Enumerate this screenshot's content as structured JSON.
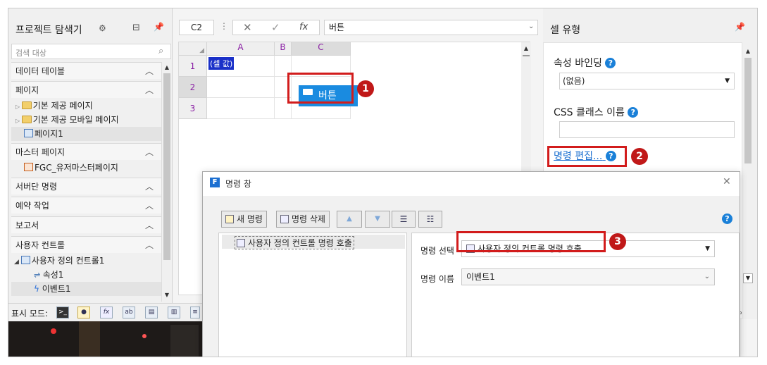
{
  "project_explorer": {
    "title": "프로젝트 탐색기",
    "search_placeholder": "검색 대상",
    "sections": [
      {
        "label": "데이터 테이블"
      },
      {
        "label": "페이지",
        "items": [
          "기본 제공 페이지",
          "기본 제공 모바일 페이지",
          "페이지1"
        ]
      },
      {
        "label": "마스터 페이지",
        "items": [
          "FGC_유저마스터페이지"
        ]
      },
      {
        "label": "서버단 명령"
      },
      {
        "label": "예약 작업"
      },
      {
        "label": "보고서"
      },
      {
        "label": "사용자 컨트롤",
        "items": [
          "사용자 정의 컨트롤1",
          "속성1",
          "이벤트1"
        ]
      }
    ],
    "display_mode_label": "표시 모드:"
  },
  "formula_bar": {
    "name_box": "C2",
    "value": "버튼"
  },
  "grid": {
    "columns": [
      "A",
      "B",
      "C"
    ],
    "rows": [
      "1",
      "2",
      "3"
    ],
    "cell_a1": "(셀 값)",
    "button_text": "버튼"
  },
  "cell_type_panel": {
    "title": "셀 유형",
    "binding_label": "속성 바인딩",
    "binding_value": "(없음)",
    "css_label": "CSS 클래스 이름",
    "css_value": "",
    "edit_command_link": "명령 편집..."
  },
  "command_dialog": {
    "title": "명령 창",
    "new_button": "새 명령",
    "delete_button": "명령 삭제",
    "list_item": "사용자 정의 컨트롤 명령 호출",
    "select_label": "명령 선택",
    "select_value": "사용자 정의 컨트롤 명령 호출",
    "name_label": "명령 이름",
    "name_value": "이벤트1"
  },
  "badges": [
    "1",
    "2",
    "3"
  ],
  "colors": {
    "accent": "#1a80d8",
    "highlight": "#d21c1c",
    "header_text": "#8a1fa4"
  }
}
